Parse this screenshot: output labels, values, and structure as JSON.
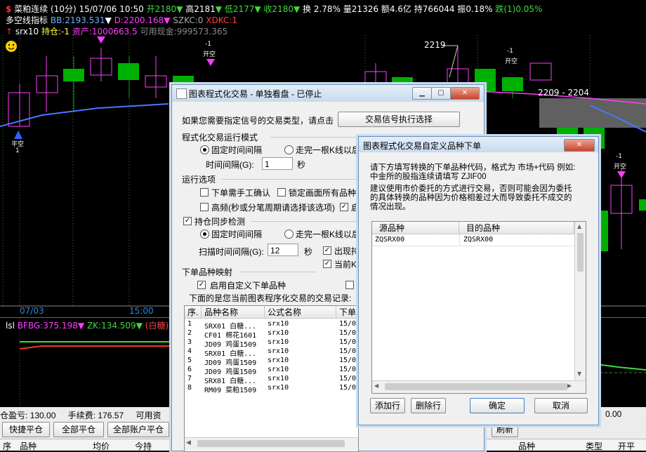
{
  "header": {
    "line1": {
      "symbol": "菜粕连续 (10分)",
      "datetime": "15/07/06 10:50",
      "open": "开2180",
      "high": "高2181",
      "low": "低2177",
      "close": "收2180",
      "turnover": "换 2.78%",
      "volume": "量21326",
      "amount": "额4.6亿",
      "position": "持766044",
      "amplitude": "振0.18%",
      "change": "跌(1)0.05%"
    },
    "line2": {
      "name": "多空线指标",
      "bb": "BB:2193.531",
      "d": "D:2200.168",
      "szkc": "SZKC:0",
      "xdkc": "XDKC:1"
    },
    "line3": {
      "strategy": "srx10",
      "position": "持仓:-1",
      "assets": "资产:1000663.5",
      "cash": "可用现金:999573.365"
    }
  },
  "chart": {
    "labels": {
      "date": "07/03",
      "time": "15:00",
      "price_2219": "2219",
      "range": "2209 - 2204",
      "open_label": "开空",
      "close_label": "平空",
      "minus1": "-1",
      "plus1": "1"
    }
  },
  "indicator": {
    "name": "lsl",
    "bfbg": "BFBG:375.198",
    "zk": "ZK:134.509",
    "suffix": "(白糖)多空"
  },
  "bottom": {
    "pnl_label": "仓盈亏:",
    "pnl": "130.00",
    "fee_label": "手续费:",
    "fee": "176.57",
    "avail_label": "可用资",
    "zero": "0.00",
    "buttons": [
      "快捷平仓",
      "全部平仓",
      "全部账户平仓"
    ],
    "refresh": "刷新",
    "cols": [
      "序",
      "品种",
      "均价",
      "今持"
    ],
    "cols_right": [
      "品种",
      "类型",
      "开平"
    ]
  },
  "main_dialog": {
    "title": "图表程式化交易 - 单独看盘 - 已停止",
    "prompt": "如果您需要指定信号的交易类型，请点击",
    "signal_btn": "交易信号执行选择",
    "sec_mode": "程式化交易运行模式",
    "fixed_interval": "固定时间间隔",
    "after_kline": "走完一根K线以后",
    "interval_label": "时间间隔(G):",
    "interval_value": "1",
    "sec_unit": "秒",
    "sec_options": "运行选项",
    "manual_confirm": "下单需手工确认",
    "lock_screen": "锁定画面所有品种",
    "hf": "高频(秒或分笔周期请选择该选项)",
    "hf_tail": "启",
    "sync": "持仓同步检测",
    "fixed_interval2": "固定时间间隔",
    "after_kline2": "走完一根K线以后",
    "scan_label": "扫描时间间隔(G):",
    "scan_value": "12",
    "scan_unit": "秒",
    "appear": "出现持",
    "current": "当前K",
    "sec_map": "下单品种映射",
    "enable_custom": "启用自定义下单品种",
    "records_label": "下面的是您当前图表程序化交易的交易记录:",
    "table_cols": [
      "序.",
      "品种名称",
      "公式名称",
      "下单"
    ],
    "records": [
      [
        "1",
        "SRX01 白糖...",
        "srx10",
        "15/07"
      ],
      [
        "2",
        "CF01 棉花1601",
        "srx10",
        "15/07"
      ],
      [
        "3",
        "JD09 鸡蛋1509",
        "srx10",
        "15/07"
      ],
      [
        "4",
        "SRX01 白糖...",
        "srx10",
        "15/07"
      ],
      [
        "5",
        "JD09 鸡蛋1509",
        "srx10",
        "15/07"
      ],
      [
        "6",
        "JD09 鸡蛋1509",
        "srx10",
        "15/07"
      ],
      [
        "7",
        "SRX01 白糖...",
        "srx10",
        "15/07"
      ],
      [
        "8",
        "RM09 菜粕1509",
        "srx10",
        "15/07"
      ]
    ]
  },
  "sub_dialog": {
    "title": "图表程式化交易自定义品种下单",
    "instr1": "请下方填写转换的下单品种代码，格式为 市场+代码 例如:",
    "instr2": "中金所的股指连续请填写 ZJIF00",
    "instr3": "建议使用市价委托的方式进行交易，否则可能会因为委托",
    "instr4": "的具体转换的品种因为价格相差过大而导致委托不成交的",
    "instr5": "情况出现。",
    "col_src": "源品种",
    "col_dst": "目的品种",
    "row_src": "ZQSRX00",
    "row_dst": "ZQSRX00",
    "add": "添加行",
    "del": "删除行",
    "ok": "确定",
    "cancel": "取消"
  }
}
